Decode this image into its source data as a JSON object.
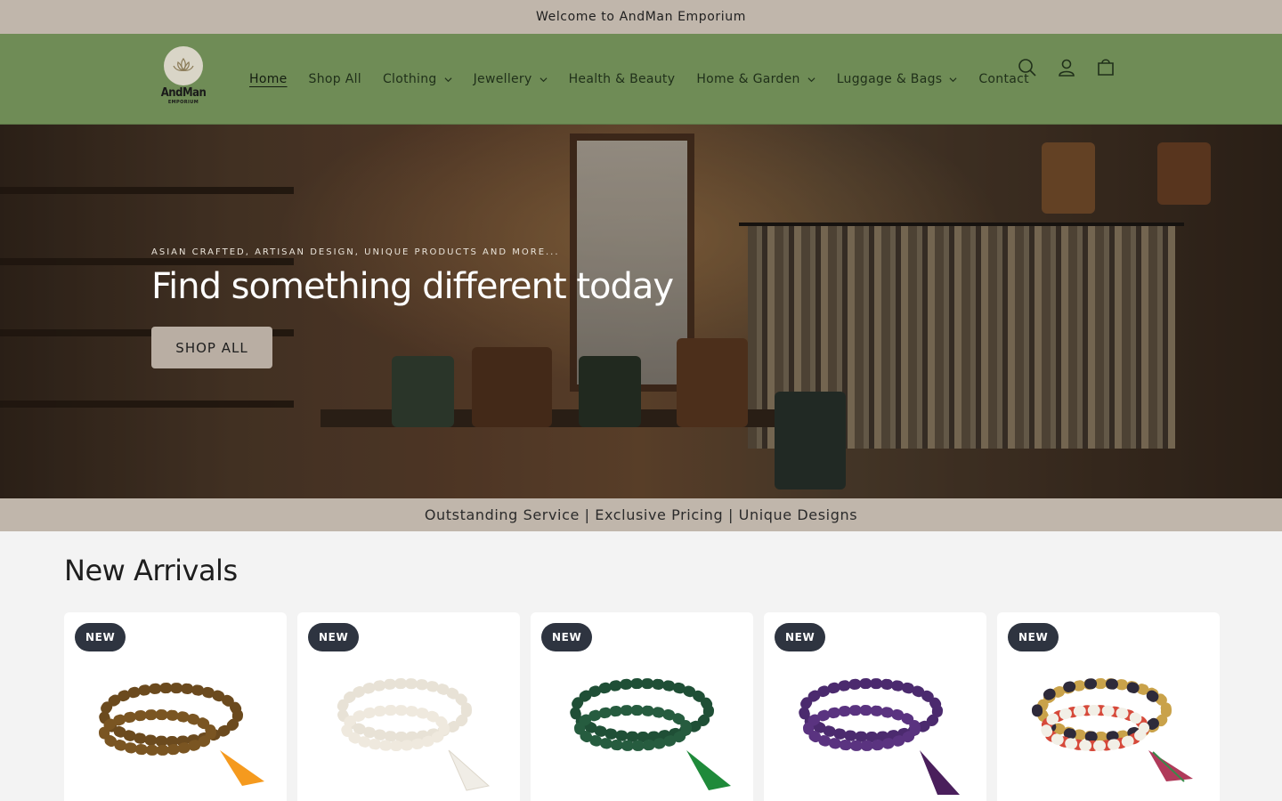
{
  "announcement": "Welcome to AndMan Emporium",
  "logo": {
    "name": "AndMan",
    "sub": "EMPORIUM"
  },
  "nav": [
    {
      "label": "Home",
      "active": true,
      "dropdown": false
    },
    {
      "label": "Shop All",
      "active": false,
      "dropdown": false
    },
    {
      "label": "Clothing",
      "active": false,
      "dropdown": true
    },
    {
      "label": "Jewellery",
      "active": false,
      "dropdown": true
    },
    {
      "label": "Health & Beauty",
      "active": false,
      "dropdown": false
    },
    {
      "label": "Home & Garden",
      "active": false,
      "dropdown": true
    },
    {
      "label": "Luggage & Bags",
      "active": false,
      "dropdown": true
    },
    {
      "label": "Contact",
      "active": false,
      "dropdown": false
    }
  ],
  "header_icons": [
    "search-icon",
    "account-icon",
    "cart-icon"
  ],
  "hero": {
    "eyebrow": "ASIAN CRAFTED, ARTISAN DESIGN, UNIQUE PRODUCTS AND MORE...",
    "title": "Find something different today",
    "button": "SHOP ALL"
  },
  "tagline": "Outstanding Service | Exclusive Pricing | Unique Designs",
  "section": {
    "title": "New Arrivals"
  },
  "products": [
    {
      "badge": "NEW",
      "bead_color": "#6b4a1e",
      "tassel_color": "#f59a1e"
    },
    {
      "badge": "NEW",
      "bead_color": "#f1ece2",
      "tassel_color": "#f4f1ea"
    },
    {
      "badge": "NEW",
      "bead_color": "#1f4f36",
      "tassel_color": "#1f8a3a"
    },
    {
      "badge": "NEW",
      "bead_color": "#4b2a6e",
      "tassel_color": "#4a1f5c"
    },
    {
      "badge": "NEW",
      "bead_color": "#c9a24a",
      "tassel_color": "#b03a5a"
    }
  ],
  "colors": {
    "announcement_bg": "#c0b6ab",
    "header_bg": "#6f8c56",
    "badge_bg": "#2e3440",
    "button_bg": "#b9aea3"
  }
}
